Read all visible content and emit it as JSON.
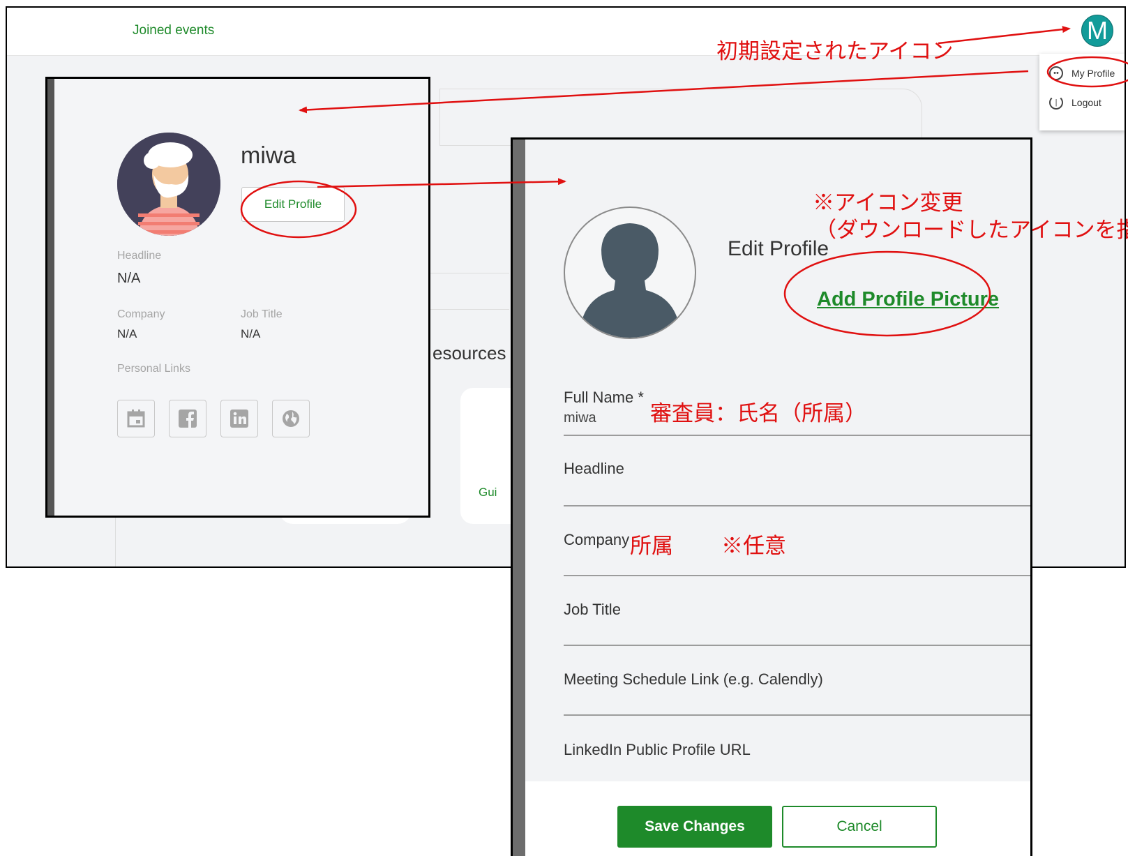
{
  "background_app": {
    "nav_joined_events": "Joined events",
    "user_initial": "M",
    "menu": {
      "my_profile": "My Profile",
      "logout": "Logout"
    },
    "fragments": {
      "resources": "esources y",
      "guide": "Gui"
    }
  },
  "profile_card": {
    "name": "miwa",
    "edit_button": "Edit Profile",
    "headline_label": "Headline",
    "headline_value": "N/A",
    "company_label": "Company",
    "company_value": "N/A",
    "job_title_label": "Job Title",
    "job_title_value": "N/A",
    "links_label": "Personal Links",
    "link_icons": [
      "calendar-icon",
      "facebook-icon",
      "linkedin-icon",
      "globe-icon"
    ]
  },
  "edit_profile": {
    "title": "Edit Profile",
    "add_picture": "Add Profile Picture",
    "fields": {
      "full_name_label": "Full Name *",
      "full_name_value": "miwa",
      "headline_label": "Headline",
      "company_label": "Company",
      "job_title_label": "Job Title",
      "meeting_label": "Meeting Schedule Link (e.g. Calendly)",
      "linkedin_label": "LinkedIn Public Profile URL"
    },
    "save_button": "Save Changes",
    "cancel_button": "Cancel"
  },
  "annotations": {
    "initial_icon": "初期設定されたアイコン",
    "icon_change_1": "※アイコン変更",
    "icon_change_2": "（ダウンロードしたアイコンを指定）",
    "reviewer_name": "審査員：氏名（所属）",
    "affiliation": "所属",
    "optional": "※任意"
  },
  "colors": {
    "accent_green": "#1e8a2a",
    "annotation_red": "#e01010",
    "avatar_teal": "#129b99"
  }
}
